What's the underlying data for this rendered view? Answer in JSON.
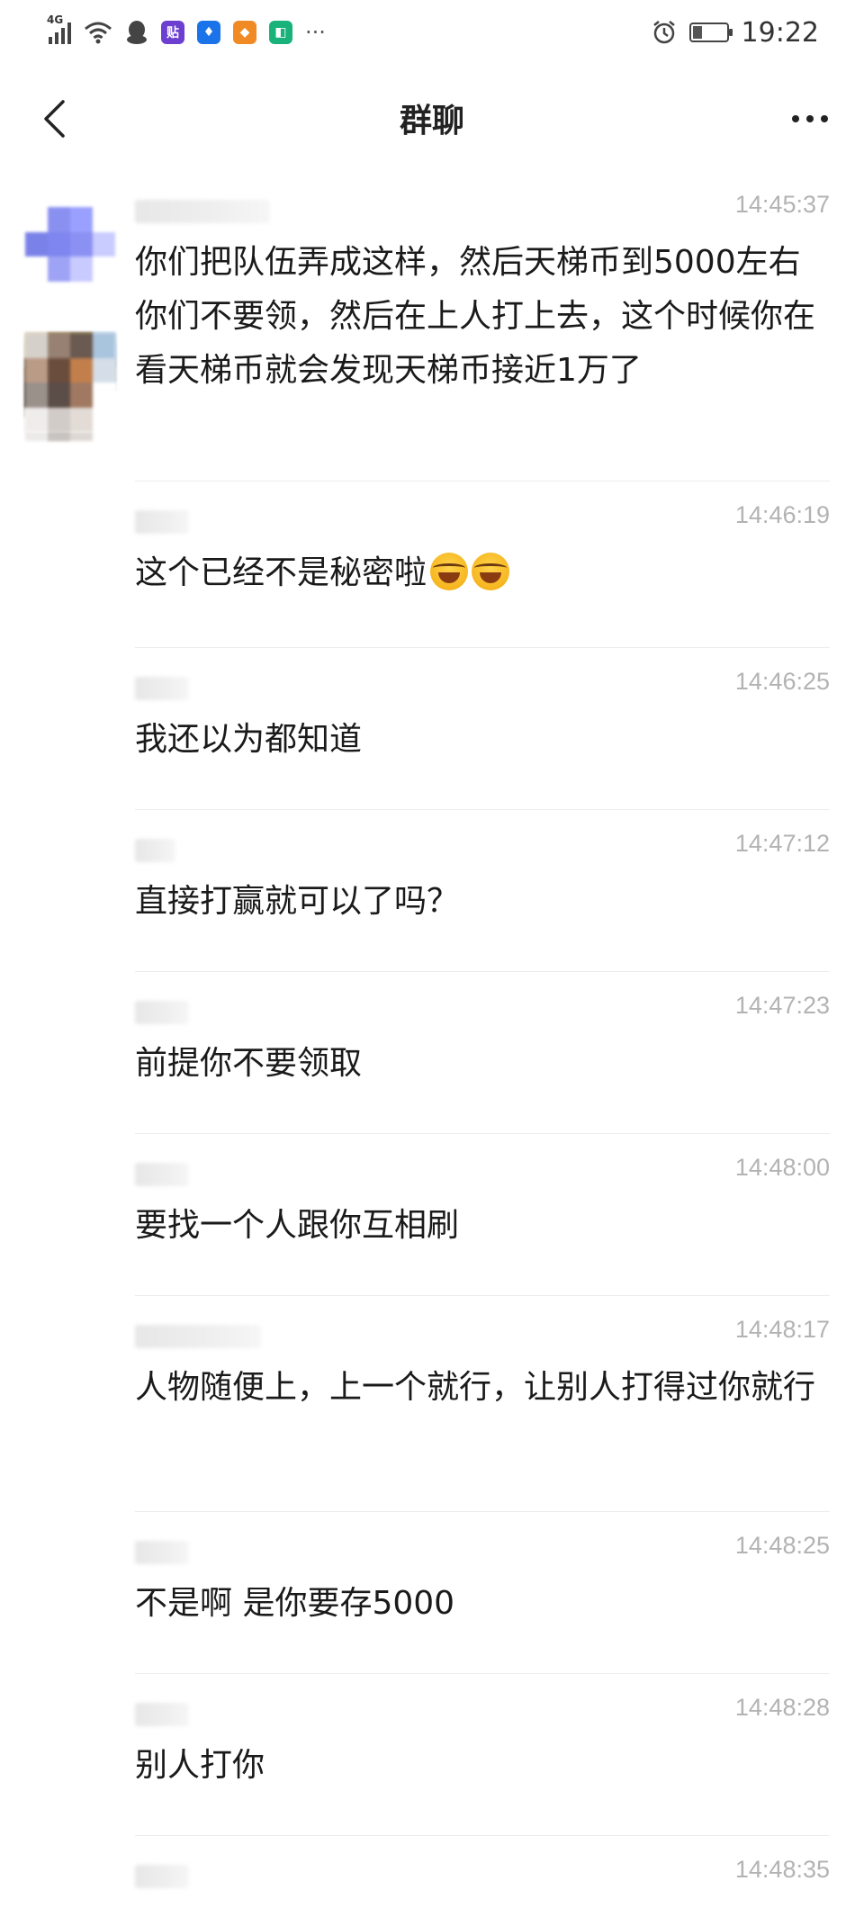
{
  "status_bar": {
    "network": "4G",
    "time": "19:22",
    "more_icons": "···",
    "icons": [
      "signal-icon",
      "wifi-icon",
      "qq-icon",
      "tieba-icon",
      "baidu-icon",
      "taobao-icon",
      "shield-icon",
      "alarm-icon",
      "battery-icon"
    ],
    "app_colors": [
      "#6c3fd1",
      "#1a73e8",
      "#f08a24",
      "#19b27b"
    ],
    "app_glyphs": [
      "贴",
      "♦",
      "◆",
      "◧"
    ],
    "battery_level": 0.3
  },
  "header": {
    "title": "群聊",
    "back_icon": "chevron-left-icon",
    "more_icon": "more-dots-icon"
  },
  "messages": [
    {
      "time": "14:45:37",
      "text": "你们把队伍弄成这样，然后天梯币到5000左右你们不要领，然后在上人打上去，这个时候你在看天梯币就会发现天梯币接近1万了",
      "emoji_count": 0
    },
    {
      "time": "14:46:19",
      "text": "这个已经不是秘密啦",
      "emoji_count": 2
    },
    {
      "time": "14:46:25",
      "text": "我还以为都知道",
      "emoji_count": 0
    },
    {
      "time": "14:47:12",
      "text": "直接打赢就可以了吗？",
      "emoji_count": 0
    },
    {
      "time": "14:47:23",
      "text": "前提你不要领取",
      "emoji_count": 0
    },
    {
      "time": "14:48:00",
      "text": "要找一个人跟你互相刷",
      "emoji_count": 0
    },
    {
      "time": "14:48:17",
      "text": "人物随便上，上一个就行，让别人打得过你就行",
      "emoji_count": 0
    },
    {
      "time": "14:48:25",
      "text": "不是啊 是你要存5000",
      "emoji_count": 0
    },
    {
      "time": "14:48:28",
      "text": "别人打你",
      "emoji_count": 0
    },
    {
      "time": "14:48:35",
      "text": "",
      "emoji_count": 0
    }
  ],
  "emoji_icon": "laughing-tears-emoji-icon",
  "colors": {
    "timestamp": "#b3b3b3",
    "divider": "#ececec",
    "text": "#1a1a1a"
  }
}
